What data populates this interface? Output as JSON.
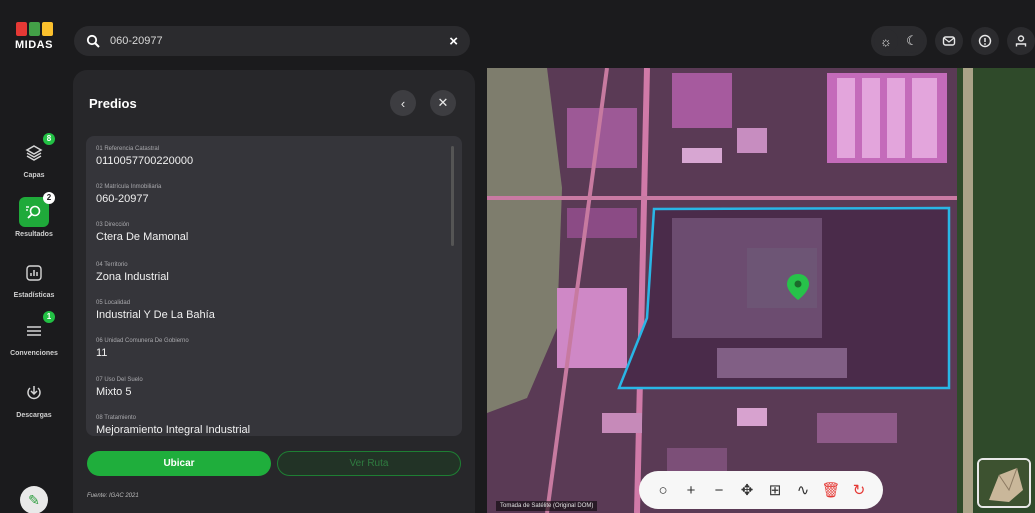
{
  "app": {
    "logo_text": "MIDAS"
  },
  "search": {
    "value": "060-20977",
    "clear_label": "×"
  },
  "sidebar": {
    "items": [
      {
        "label": "Capas",
        "badge": "8",
        "icon": "layers-icon"
      },
      {
        "label": "Resultados",
        "badge": "2",
        "icon": "search-results-icon",
        "active": true
      },
      {
        "label": "Estadísticas",
        "badge": "",
        "icon": "stats-icon"
      },
      {
        "label": "Convenciones",
        "badge": "1",
        "icon": "legend-list-icon"
      },
      {
        "label": "Descargas",
        "badge": "",
        "icon": "download-icon"
      }
    ]
  },
  "panel": {
    "title": "Predios",
    "fields": [
      {
        "label": "01 Referencia Catastral",
        "value": "0110057700220000"
      },
      {
        "label": "02 Matrícula Inmobiliaria",
        "value": "060-20977"
      },
      {
        "label": "03 Dirección",
        "value": "Ctera De Mamonal"
      },
      {
        "label": "04 Territorio",
        "value": "Zona Industrial"
      },
      {
        "label": "05 Localidad",
        "value": "Industrial Y De La Bahía"
      },
      {
        "label": "06 Unidad Comunera De Gobierno",
        "value": "11"
      },
      {
        "label": "07 Uso Del Suelo",
        "value": "Mixto 5"
      },
      {
        "label": "08 Tratamiento",
        "value": "Mejoramiento Integral Industrial"
      }
    ],
    "primary_button": "Ubicar",
    "secondary_button": "Ver Ruta",
    "source": "Fuente: IGAC 2021"
  },
  "map": {
    "attribution": "Tomada de Satélite (Original DOM)"
  },
  "colors": {
    "accent": "#1fae3c",
    "parcel_outline": "#29b6e6",
    "overlay": "#b14fa8"
  }
}
